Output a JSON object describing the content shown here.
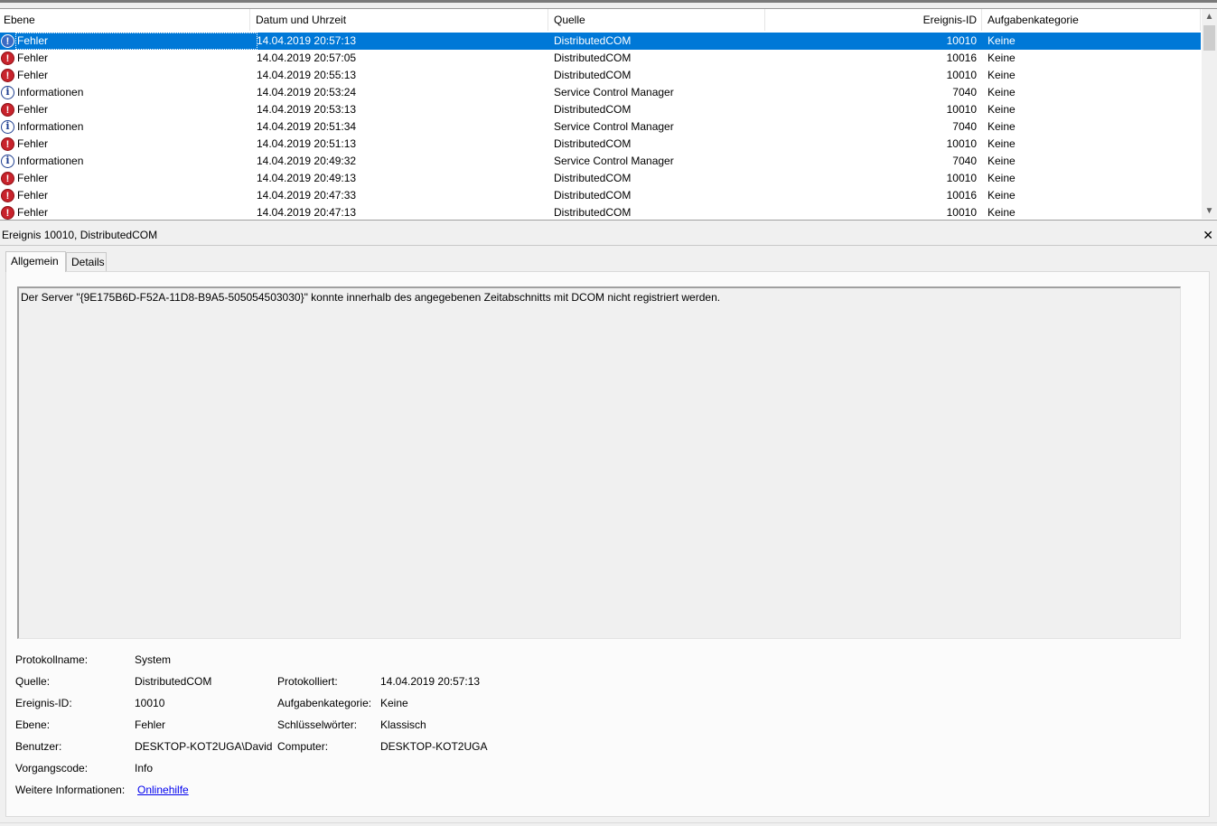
{
  "columns": {
    "level": "Ebene",
    "datetime": "Datum und Uhrzeit",
    "source": "Quelle",
    "event_id": "Ereignis-ID",
    "task_category": "Aufgabenkategorie"
  },
  "events": [
    {
      "type": "error",
      "level": "Fehler",
      "datetime": "14.04.2019 20:57:13",
      "source": "DistributedCOM",
      "event_id": "10010",
      "category": "Keine",
      "selected": true
    },
    {
      "type": "error",
      "level": "Fehler",
      "datetime": "14.04.2019 20:57:05",
      "source": "DistributedCOM",
      "event_id": "10016",
      "category": "Keine"
    },
    {
      "type": "error",
      "level": "Fehler",
      "datetime": "14.04.2019 20:55:13",
      "source": "DistributedCOM",
      "event_id": "10010",
      "category": "Keine"
    },
    {
      "type": "info",
      "level": "Informationen",
      "datetime": "14.04.2019 20:53:24",
      "source": "Service Control Manager",
      "event_id": "7040",
      "category": "Keine"
    },
    {
      "type": "error",
      "level": "Fehler",
      "datetime": "14.04.2019 20:53:13",
      "source": "DistributedCOM",
      "event_id": "10010",
      "category": "Keine"
    },
    {
      "type": "info",
      "level": "Informationen",
      "datetime": "14.04.2019 20:51:34",
      "source": "Service Control Manager",
      "event_id": "7040",
      "category": "Keine"
    },
    {
      "type": "error",
      "level": "Fehler",
      "datetime": "14.04.2019 20:51:13",
      "source": "DistributedCOM",
      "event_id": "10010",
      "category": "Keine"
    },
    {
      "type": "info",
      "level": "Informationen",
      "datetime": "14.04.2019 20:49:32",
      "source": "Service Control Manager",
      "event_id": "7040",
      "category": "Keine"
    },
    {
      "type": "error",
      "level": "Fehler",
      "datetime": "14.04.2019 20:49:13",
      "source": "DistributedCOM",
      "event_id": "10010",
      "category": "Keine"
    },
    {
      "type": "error",
      "level": "Fehler",
      "datetime": "14.04.2019 20:47:33",
      "source": "DistributedCOM",
      "event_id": "10016",
      "category": "Keine"
    },
    {
      "type": "error",
      "level": "Fehler",
      "datetime": "14.04.2019 20:47:13",
      "source": "DistributedCOM",
      "event_id": "10010",
      "category": "Keine"
    }
  ],
  "icons": {
    "error": "error-icon",
    "info": "info-icon",
    "close": "close-icon"
  },
  "colors": {
    "selection": "#0078d7",
    "error_icon": "#c8232c",
    "info_icon": "#1f3f91",
    "link": "#0000ee"
  },
  "detail": {
    "title": "Ereignis 10010, DistributedCOM",
    "close_glyph": "✕",
    "tabs": {
      "general": "Allgemein",
      "details": "Details"
    },
    "message": "Der Server \"{9E175B6D-F52A-11D8-B9A5-505054503030}\" konnte innerhalb des angegebenen Zeitabschnitts mit DCOM nicht registriert werden.",
    "labels": {
      "log_name": "Protokollname:",
      "source": "Quelle:",
      "logged": "Protokolliert:",
      "event_id": "Ereignis-ID:",
      "task_category": "Aufgabenkategorie:",
      "level": "Ebene:",
      "keywords": "Schlüsselwörter:",
      "user": "Benutzer:",
      "computer": "Computer:",
      "opcode": "Vorgangscode:",
      "more_info": "Weitere Informationen:"
    },
    "values": {
      "log_name": "System",
      "source": "DistributedCOM",
      "logged": "14.04.2019 20:57:13",
      "event_id": "10010",
      "task_category": "Keine",
      "level": "Fehler",
      "keywords": "Klassisch",
      "user": "DESKTOP-KOT2UGA\\David",
      "computer": "DESKTOP-KOT2UGA",
      "opcode": "Info",
      "more_info_link": "Onlinehilfe"
    }
  }
}
